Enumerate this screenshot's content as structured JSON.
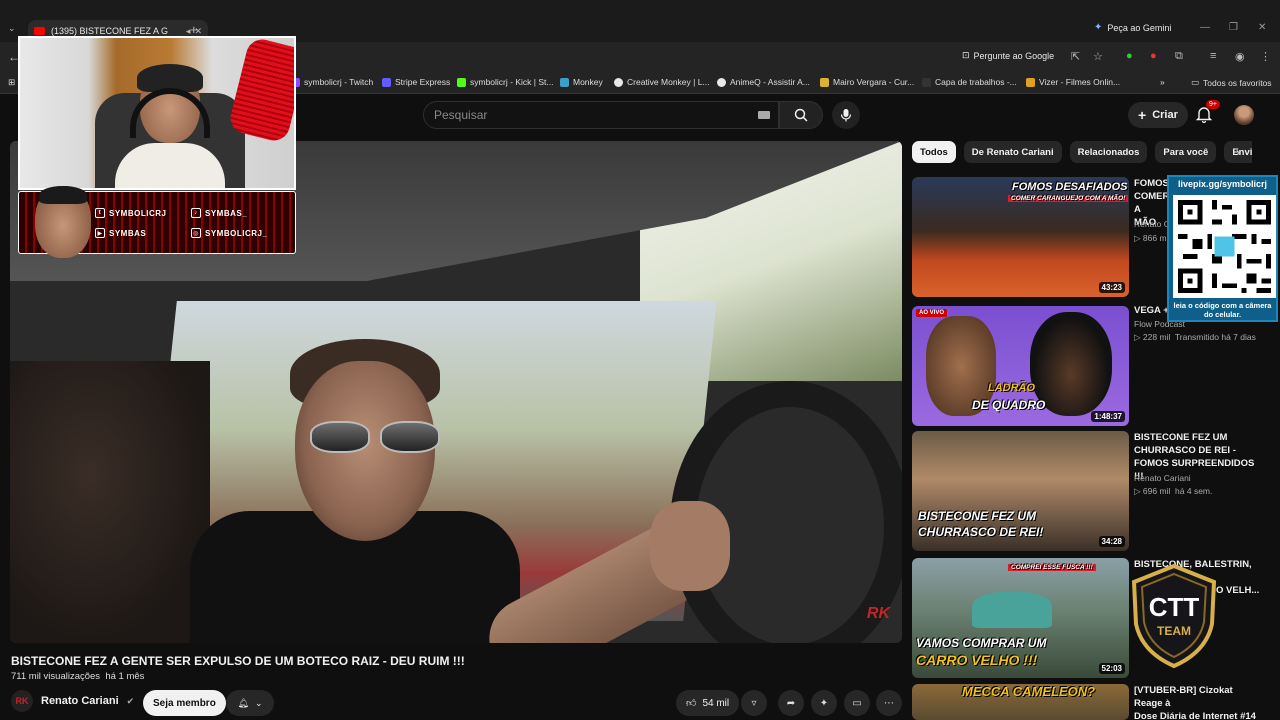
{
  "browser": {
    "tab_title": "(1395) BISTECONE FEZ A G",
    "gemini_label": "Peça ao Gemini",
    "google_search_label": "Pergunte ao Google",
    "bookmarks": [
      {
        "label": "symbolicrj - Twitch",
        "color": "#9146ff"
      },
      {
        "label": "Stripe Express",
        "color": "#635bff"
      },
      {
        "label": "symbolicrj - Kick | St...",
        "color": "#53fc18"
      },
      {
        "label": "Monkey",
        "color": "#3aa0c9"
      },
      {
        "label": "Creative Monkey | L...",
        "color": "#e8e8e8"
      },
      {
        "label": "AnimeQ - Assistir A...",
        "color": "#e8e8e8"
      },
      {
        "label": "Mairo Vergara - Cur...",
        "color": "#e0b030"
      },
      {
        "label": "Capa de trabalhos -...",
        "color": "#333333"
      },
      {
        "label": "Vizer - Filmes Onlin...",
        "color": "#e0a020"
      }
    ],
    "all_favorites": "Todos os favoritos"
  },
  "youtube": {
    "search_placeholder": "Pesquisar",
    "create_label": "Criar",
    "notif_count": "9+"
  },
  "video": {
    "title": "BISTECONE FEZ A GENTE SER EXPULSO DE UM BOTECO RAIZ - DEU RUIM !!!",
    "views": "711 mil visualizações",
    "age": "há 1 mês",
    "channel": "Renato Cariani",
    "member_button": "Seja membro",
    "likes": "54 mil"
  },
  "chips": [
    "Todos",
    "De Renato Cariani",
    "Relacionados",
    "Para você",
    "Envi"
  ],
  "recommendations": [
    {
      "title": "FOMOS DESAFIADOS - COMER CARANGUEJO COM A MÃO",
      "title_visible": "FOMOS\nCOMER\nA MÃO",
      "channel": "Renato C",
      "stats": "866 m",
      "duration": "43:23",
      "thumb_caption": "FOMOS DESAFIADOS",
      "thumb_sub": "COMER CARANGUEJO COM A MÃO!"
    },
    {
      "title": "VEGA +",
      "channel": "Flow Podcast",
      "stats_views": "228 mil",
      "stats_age": "Transmitido há 7 dias",
      "duration": "1:48:37",
      "live_badge": "AO VIVO",
      "thumb_caption": "LADRÃO",
      "thumb_sub": "DE QUADRO"
    },
    {
      "title": "BISTECONE FEZ UM CHURRASCO DE REI - FOMOS SURPREENDIDOS !!!",
      "channel": "Renato Cariani",
      "stats_views": "696 mil",
      "stats_age": "há 4 sem.",
      "duration": "34:28",
      "thumb_caption": "BISTECONE FEZ UM",
      "thumb_sub": "CHURRASCO DE REI!"
    },
    {
      "title": "BISTECONE, BALESTRIN,",
      "title_line2": "O -",
      "title_line3": "O VELH...",
      "duration": "52:03",
      "thumb_caption": "VAMOS COMPRAR UM",
      "thumb_sub": "CARRO VELHO !!!",
      "thumb_tag": "COMPREI ESSE FUSCA !!!"
    },
    {
      "title": "[VTUBER-BR] Cizokat Reage à",
      "title_line2": "Dose Diária de Internet #14",
      "thumb_caption": "MECCA CAMELEON?"
    }
  ],
  "overlay": {
    "socials": [
      {
        "label": "SYMBOLICRJ",
        "icon": "twitch-icon"
      },
      {
        "label": "SYMBAS_",
        "icon": "tiktok-icon"
      },
      {
        "label": "SYMBAS",
        "icon": "youtube-icon"
      },
      {
        "label": "SYMBOLICRJ_",
        "icon": "instagram-icon"
      }
    ],
    "qr_url": "livepix.gg/symbolicrj",
    "qr_note": "leia o código com a câmera do celular.",
    "ctt_line1": "CTT",
    "ctt_line2": "TEAM"
  }
}
